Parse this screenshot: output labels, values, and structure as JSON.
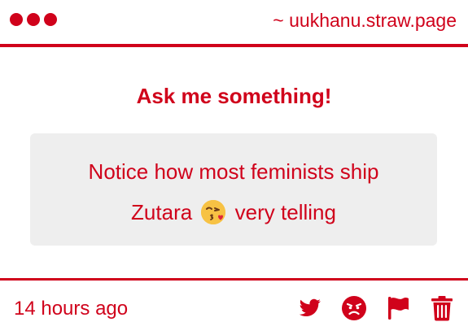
{
  "header": {
    "site": "~ uukhanu.straw.page",
    "dots_color": "#d0021b"
  },
  "main": {
    "title": "Ask me something!",
    "question_line1": "Notice how most feminists ship",
    "question_line2_before": "Zutara",
    "question_emoji": "face-blowing-a-kiss-emoji",
    "question_line2_after": "very telling"
  },
  "footer": {
    "timestamp": "14 hours ago",
    "actions": [
      "twitter-icon",
      "angry-face-icon",
      "flag-icon",
      "trash-icon"
    ]
  },
  "colors": {
    "accent": "#d0021b",
    "box_bg": "#eeeeee"
  }
}
